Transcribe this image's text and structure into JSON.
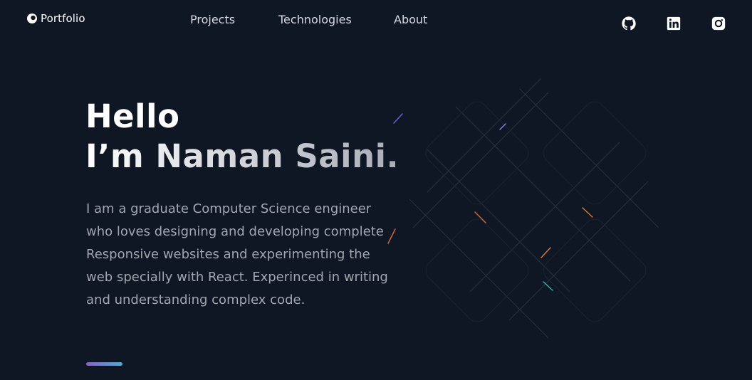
{
  "header": {
    "logo_label": "Portfolio",
    "nav": [
      {
        "label": "Projects"
      },
      {
        "label": "Technologies"
      },
      {
        "label": "About"
      }
    ],
    "social": [
      {
        "icon": "github-icon"
      },
      {
        "icon": "linkedin-icon"
      },
      {
        "icon": "instagram-icon"
      }
    ]
  },
  "hero": {
    "greeting": "Hello",
    "name_line": "I’m Naman Saini.",
    "description": "I am a graduate Computer Science engineer who loves designing and developing complete Responsive websites and experimenting the web specially with React. Experinced in writing and understanding complex code."
  },
  "colors": {
    "background": "#0f1624",
    "accent_start": "#8a5fd6",
    "accent_end": "#3fb0e0",
    "text_muted": "#a2a6ae"
  }
}
